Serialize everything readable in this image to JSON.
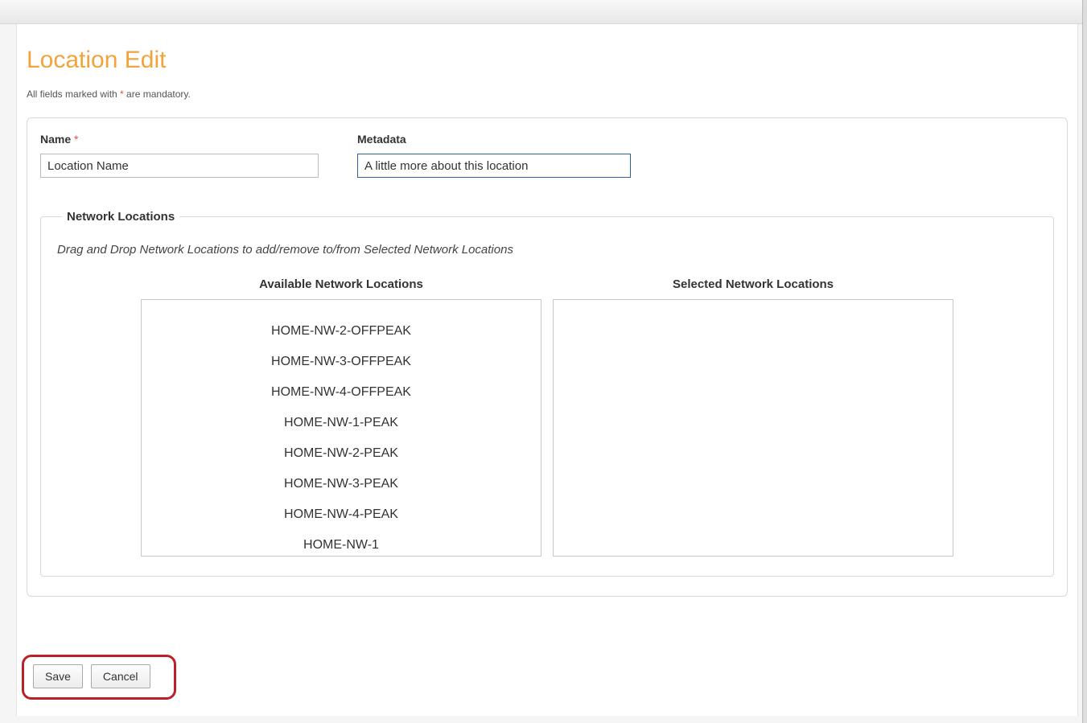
{
  "page": {
    "title": "Location Edit",
    "mandatory_note_prefix": "All fields marked with ",
    "mandatory_note_ast": "*",
    "mandatory_note_suffix": " are mandatory."
  },
  "form": {
    "name": {
      "label": "Name ",
      "required_mark": "*",
      "value": "Location Name"
    },
    "metadata": {
      "label": "Metadata",
      "value": "A little more about this location"
    }
  },
  "netloc": {
    "legend": "Network Locations",
    "hint": "Drag and Drop Network Locations to add/remove to/from Selected Network Locations",
    "available_title": "Available Network Locations",
    "selected_title": "Selected Network Locations",
    "available_items": [
      "HOME-NW-2-OFFPEAK",
      "HOME-NW-3-OFFPEAK",
      "HOME-NW-4-OFFPEAK",
      "HOME-NW-1-PEAK",
      "HOME-NW-2-PEAK",
      "HOME-NW-3-PEAK",
      "HOME-NW-4-PEAK",
      "HOME-NW-1"
    ],
    "selected_items": []
  },
  "buttons": {
    "save": "Save",
    "cancel": "Cancel"
  }
}
